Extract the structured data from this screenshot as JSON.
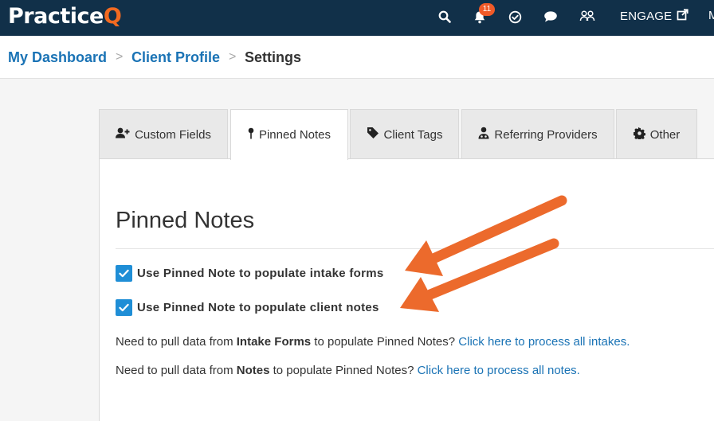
{
  "app": {
    "logo_main": "Practice",
    "logo_accent": "Q"
  },
  "topbar": {
    "notifications_count": "11",
    "engage_label": "ENGAGE",
    "more_label": "M",
    "icons": [
      "search-icon",
      "bell-icon",
      "check-circle-icon",
      "chat-icon",
      "users-icon",
      "external-link-icon"
    ]
  },
  "breadcrumb": {
    "items": [
      "My Dashboard",
      "Client Profile",
      "Settings"
    ],
    "separator": ">"
  },
  "tabs": [
    {
      "label": "Custom Fields",
      "icon": "user-plus-icon",
      "active": false
    },
    {
      "label": "Pinned Notes",
      "icon": "pin-icon",
      "active": true
    },
    {
      "label": "Client Tags",
      "icon": "tag-icon",
      "active": false
    },
    {
      "label": "Referring Providers",
      "icon": "provider-icon",
      "active": false
    },
    {
      "label": "Other",
      "icon": "gear-icon",
      "active": false
    }
  ],
  "main": {
    "title": "Pinned Notes",
    "options": [
      {
        "label": "Use Pinned Note to populate intake forms",
        "checked": true
      },
      {
        "label": "Use Pinned Note to populate client notes",
        "checked": true
      }
    ],
    "intake_help": {
      "prefix": "Need to pull data from ",
      "bold": "Intake Forms",
      "middle": " to populate Pinned Notes? ",
      "link": "Click here to process all intakes."
    },
    "notes_help": {
      "prefix": "Need to pull data from ",
      "bold": "Notes",
      "middle": " to populate Pinned Notes? ",
      "link": "Click here to process all notes."
    }
  },
  "colors": {
    "topbar": "#113049",
    "accent_orange": "#f26a21",
    "link_blue": "#1a73b5",
    "checkbox_blue": "#1f8ed6",
    "annotation_arrow": "#ec6a2c"
  }
}
